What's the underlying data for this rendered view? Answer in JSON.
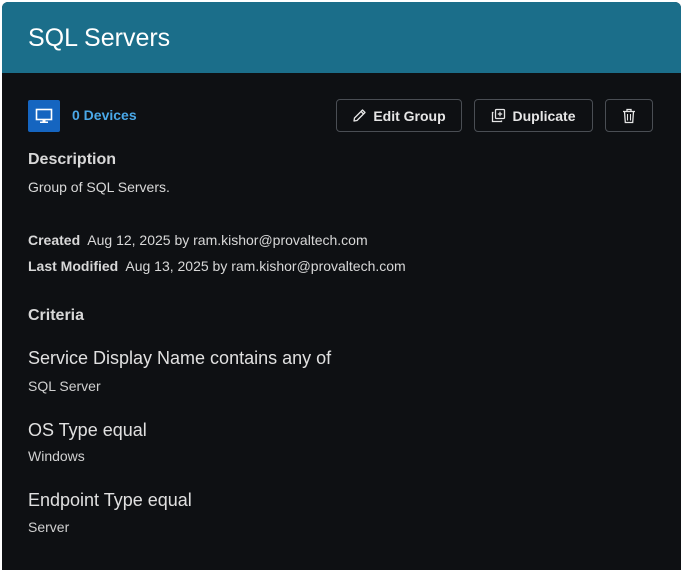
{
  "header": {
    "title": "SQL Servers"
  },
  "devices": {
    "count_label": "0 Devices",
    "icon": "monitor-icon"
  },
  "toolbar": {
    "edit_label": "Edit Group",
    "edit_icon": "pencil-icon",
    "duplicate_label": "Duplicate",
    "duplicate_icon": "duplicate-icon",
    "delete_icon": "trash-icon"
  },
  "description": {
    "title": "Description",
    "text": "Group of SQL Servers."
  },
  "meta": {
    "created_label": "Created",
    "created_value": "Aug 12, 2025 by ram.kishor@provaltech.com",
    "modified_label": "Last Modified",
    "modified_value": "Aug 13, 2025 by ram.kishor@provaltech.com"
  },
  "criteria": {
    "title": "Criteria",
    "items": [
      {
        "name": "Service Display Name contains any of",
        "value": "SQL Server"
      },
      {
        "name": "OS Type equal",
        "value": "Windows"
      },
      {
        "name": "Endpoint Type equal",
        "value": "Server"
      }
    ]
  },
  "colors": {
    "header_bg": "#1b6e8a",
    "panel_bg": "#0e1013",
    "accent_link": "#4aa8e8",
    "device_badge": "#1565c0"
  }
}
